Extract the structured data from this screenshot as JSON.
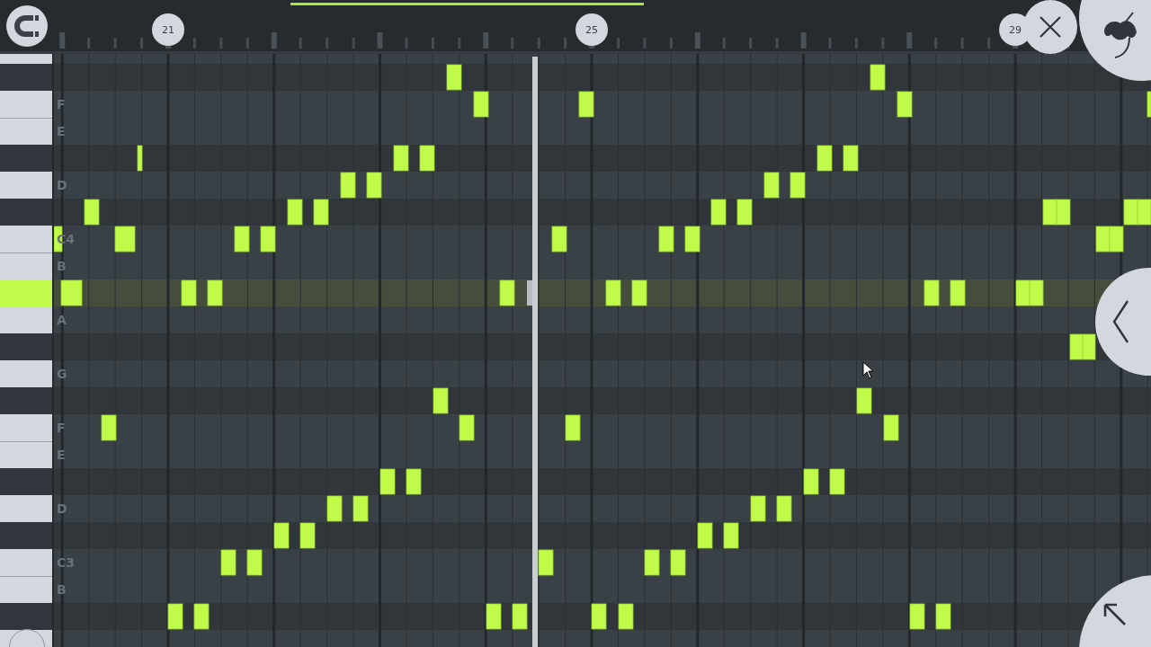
{
  "ruler": {
    "bar_numbers": [
      "21",
      "25",
      "29"
    ]
  },
  "piano_keys": [
    {
      "kind": "white",
      "selected": false
    },
    {
      "kind": "black",
      "selected": false
    },
    {
      "kind": "white",
      "selected": false,
      "label": "F"
    },
    {
      "kind": "white",
      "selected": false,
      "label": "E"
    },
    {
      "kind": "black",
      "selected": false
    },
    {
      "kind": "white",
      "selected": false,
      "label": "D"
    },
    {
      "kind": "black",
      "selected": false
    },
    {
      "kind": "white",
      "selected": false,
      "label": "C4"
    },
    {
      "kind": "white",
      "selected": false,
      "label": "B"
    },
    {
      "kind": "black",
      "selected": true
    },
    {
      "kind": "white",
      "selected": false,
      "label": "A"
    },
    {
      "kind": "black",
      "selected": false
    },
    {
      "kind": "white",
      "selected": false,
      "label": "G"
    },
    {
      "kind": "black",
      "selected": false
    },
    {
      "kind": "white",
      "selected": false,
      "label": "F"
    },
    {
      "kind": "white",
      "selected": false,
      "label": "E"
    },
    {
      "kind": "black",
      "selected": false
    },
    {
      "kind": "white",
      "selected": false,
      "label": "D"
    },
    {
      "kind": "black",
      "selected": false
    },
    {
      "kind": "white",
      "selected": false,
      "label": "C3"
    },
    {
      "kind": "white",
      "selected": false,
      "label": "B"
    },
    {
      "kind": "black",
      "selected": false
    },
    {
      "kind": "white",
      "selected": false
    }
  ]
}
